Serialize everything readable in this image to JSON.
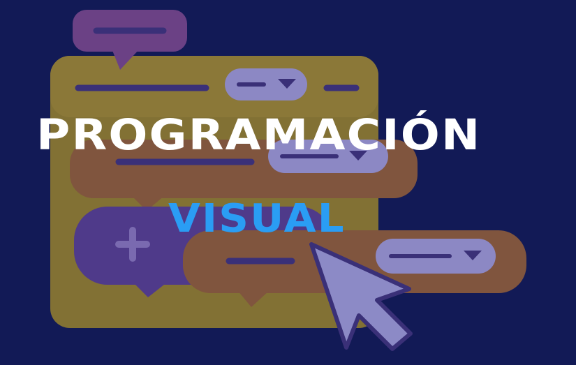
{
  "title": {
    "line1": "PROGRAMACIÓN",
    "line2": "VISUAL"
  },
  "colors": {
    "background": "#121a56",
    "title_line1": "#ffffff",
    "title_line2": "#2a9df4",
    "block_yellow": "#827134",
    "block_orange": "#80553e",
    "block_purple": "#4f3a8a",
    "block_magenta": "#6b4185",
    "dropdown": "#8c88c4",
    "cursor": "#8c8ac6"
  },
  "icons": {
    "plus": "plus-icon",
    "dropdown_arrow": "triangle-down-icon",
    "cursor": "mouse-pointer-icon"
  }
}
